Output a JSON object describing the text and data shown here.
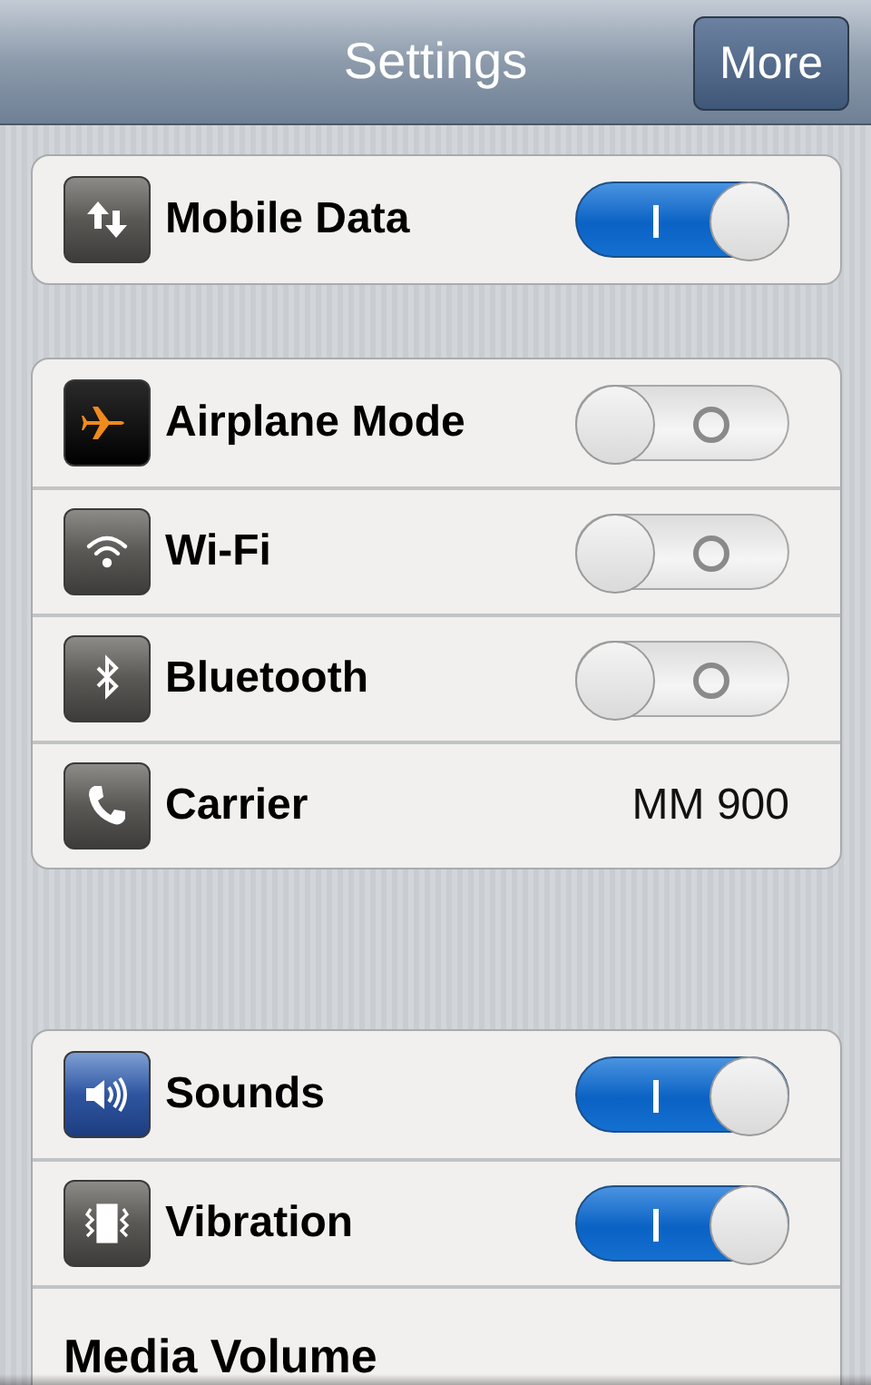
{
  "header": {
    "title": "Settings",
    "button": "More"
  },
  "groups": [
    {
      "rows": [
        {
          "kind": "toggle",
          "label": "Mobile Data",
          "on": true
        }
      ]
    },
    {
      "rows": [
        {
          "kind": "toggle",
          "label": "Airplane Mode",
          "on": false
        },
        {
          "kind": "toggle",
          "label": "Wi-Fi",
          "on": false
        },
        {
          "kind": "toggle",
          "label": "Bluetooth",
          "on": false
        },
        {
          "kind": "value",
          "label": "Carrier",
          "value": "MM 900"
        }
      ]
    },
    {
      "rows": [
        {
          "kind": "toggle",
          "label": "Sounds",
          "on": true
        },
        {
          "kind": "toggle",
          "label": "Vibration",
          "on": true
        },
        {
          "kind": "heading",
          "label": "Media Volume"
        }
      ]
    }
  ]
}
